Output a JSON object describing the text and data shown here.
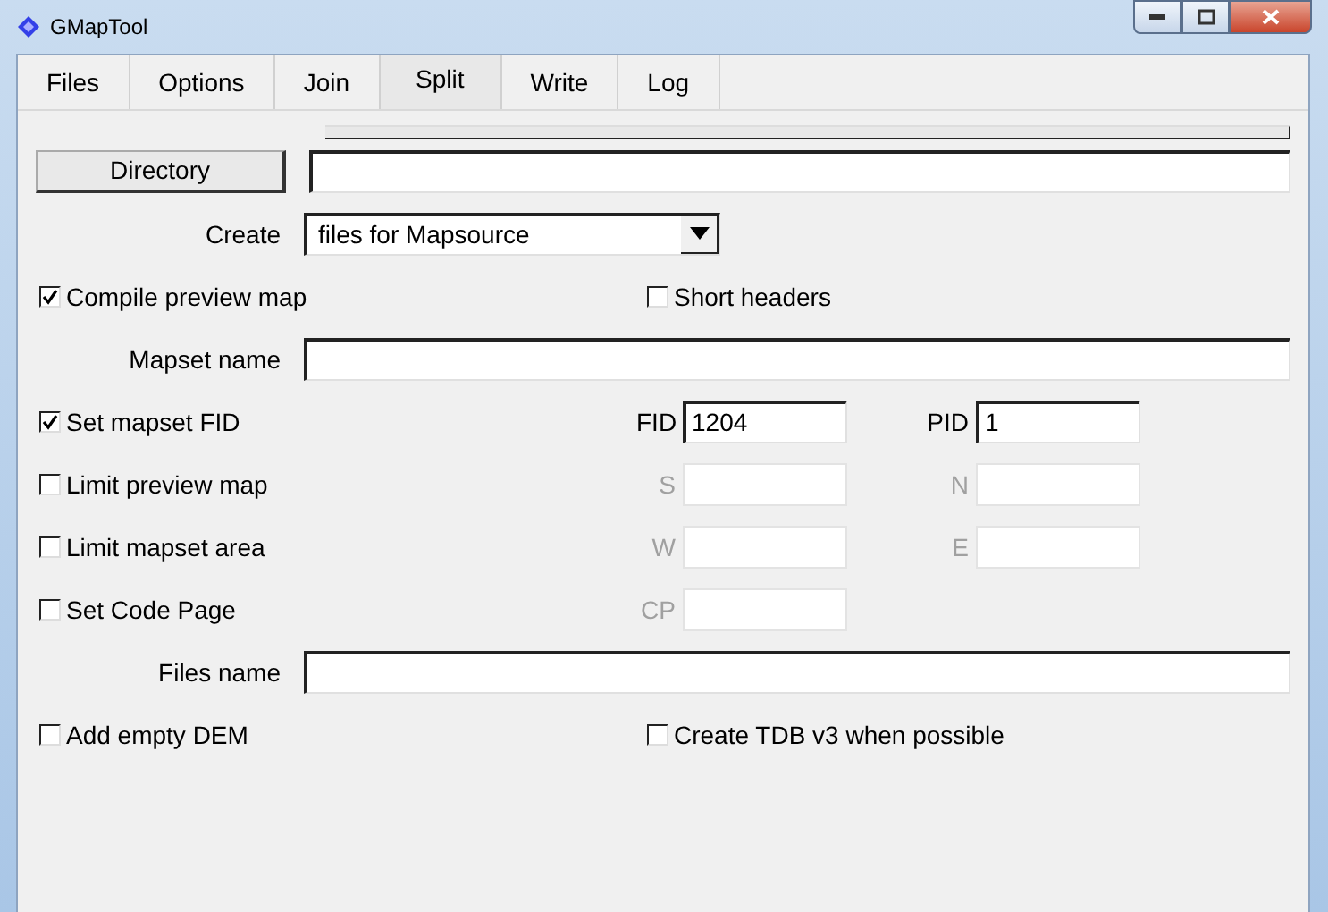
{
  "window": {
    "title": "GMapTool"
  },
  "tabs": [
    {
      "label": "Files",
      "selected": false
    },
    {
      "label": "Options",
      "selected": false
    },
    {
      "label": "Join",
      "selected": false
    },
    {
      "label": "Split",
      "selected": true
    },
    {
      "label": "Write",
      "selected": false
    },
    {
      "label": "Log",
      "selected": false
    }
  ],
  "rows": [
    {
      "kind": "button-field",
      "label": "Directory"
    },
    {
      "kind": "select",
      "label": "Create",
      "value": "files for Mapsource"
    },
    {
      "kind": "checks",
      "checks": [
        {
          "label": "Compile preview map",
          "checked": true
        },
        {
          "label": "Short headers",
          "checked": false
        }
      ]
    },
    {
      "kind": "text",
      "label": "Mapset name"
    },
    {
      "kind": "check-fields",
      "check": {
        "label": "Set mapset FID",
        "checked": true
      },
      "fields": [
        {
          "label": "FID",
          "value": "1204",
          "disabled": false
        },
        {
          "label": "PID",
          "value": "1",
          "disabled": false
        }
      ]
    },
    {
      "kind": "check-fields",
      "check": {
        "label": "Limit preview map",
        "checked": false
      },
      "fields": [
        {
          "label": "S",
          "disabled": true
        },
        {
          "label": "N",
          "disabled": true
        }
      ]
    },
    {
      "kind": "check-fields",
      "check": {
        "label": "Limit mapset area",
        "checked": false
      },
      "fields": [
        {
          "label": "W",
          "disabled": true
        },
        {
          "label": "E",
          "disabled": true
        }
      ]
    },
    {
      "kind": "check-fields",
      "check": {
        "label": "Set Code Page",
        "checked": false
      },
      "fields": [
        {
          "label": "CP",
          "disabled": true
        }
      ]
    },
    {
      "kind": "text",
      "label": "Files name"
    },
    {
      "kind": "checks",
      "checks": [
        {
          "label": "Add empty DEM",
          "checked": false
        },
        {
          "label": "Create TDB v3 when possible",
          "checked": false
        }
      ]
    }
  ]
}
